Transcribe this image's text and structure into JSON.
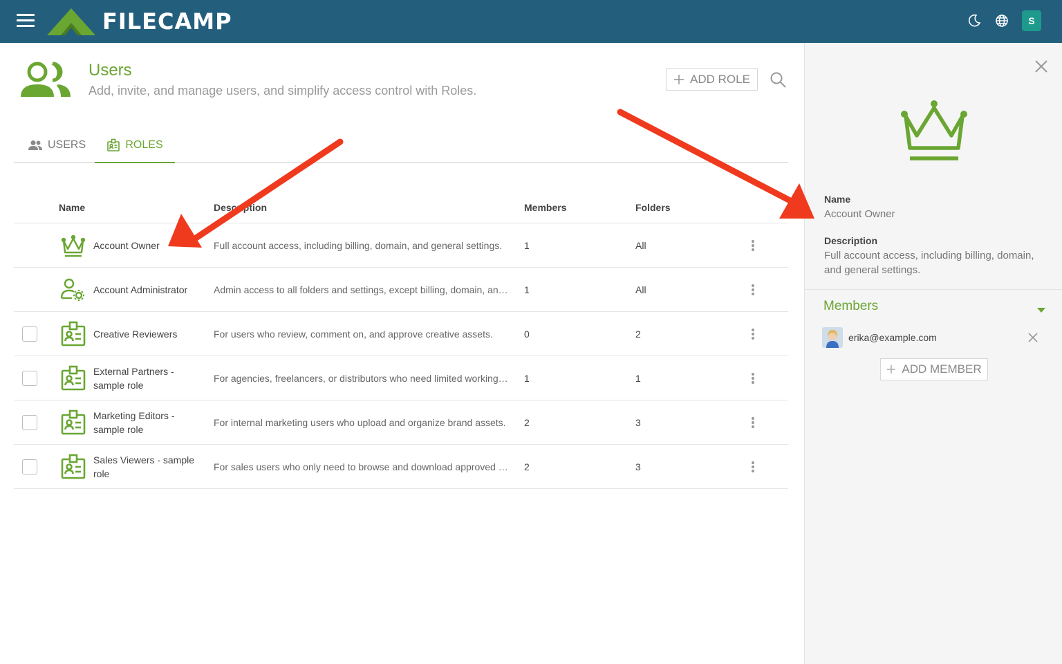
{
  "app": {
    "brand": "FILECAMP",
    "user_initial": "S"
  },
  "header": {
    "title": "Users",
    "subtitle": "Add, invite, and manage users, and simplify access control with Roles.",
    "add_role_label": "ADD ROLE"
  },
  "tabs": [
    {
      "label": "USERS",
      "active": false
    },
    {
      "label": "ROLES",
      "active": true
    }
  ],
  "table": {
    "columns": [
      "Name",
      "Description",
      "Members",
      "Folders"
    ],
    "rows": [
      {
        "name": "Account Owner",
        "description": "Full account access, including billing, domain, and general settings.",
        "members": "1",
        "folders": "All",
        "icon": "crown-icon",
        "checkbox": false
      },
      {
        "name": "Account Administrator",
        "description": "Admin access to all folders and settings, except billing, domain, and…",
        "members": "1",
        "folders": "All",
        "icon": "user-gear-icon",
        "checkbox": false
      },
      {
        "name": "Creative Reviewers",
        "description": "For users who review, comment on, and approve creative assets.",
        "members": "0",
        "folders": "2",
        "icon": "id-badge-icon",
        "checkbox": true
      },
      {
        "name": "External Partners - sample role",
        "description": "For agencies, freelancers, or distributors who need limited working …",
        "members": "1",
        "folders": "1",
        "icon": "id-badge-icon",
        "checkbox": true
      },
      {
        "name": "Marketing Editors - sample role",
        "description": "For internal marketing users who upload and organize brand assets.",
        "members": "2",
        "folders": "3",
        "icon": "id-badge-icon",
        "checkbox": true
      },
      {
        "name": "Sales Viewers - sample role",
        "description": "For sales users who only need to browse and download approved m…",
        "members": "2",
        "folders": "3",
        "icon": "id-badge-icon",
        "checkbox": true
      }
    ]
  },
  "panel": {
    "name_label": "Name",
    "name_value": "Account Owner",
    "description_label": "Description",
    "description_value": "Full account access, including billing, domain, and general settings.",
    "members_title": "Members",
    "members": [
      {
        "email": "erika@example.com"
      }
    ],
    "add_member_label": "ADD MEMBER"
  },
  "colors": {
    "topbar": "#235f7c",
    "accent_green": "#6aa632",
    "avatar_teal": "#1e9a8c",
    "annotation_arrow": "#f03a1e"
  }
}
